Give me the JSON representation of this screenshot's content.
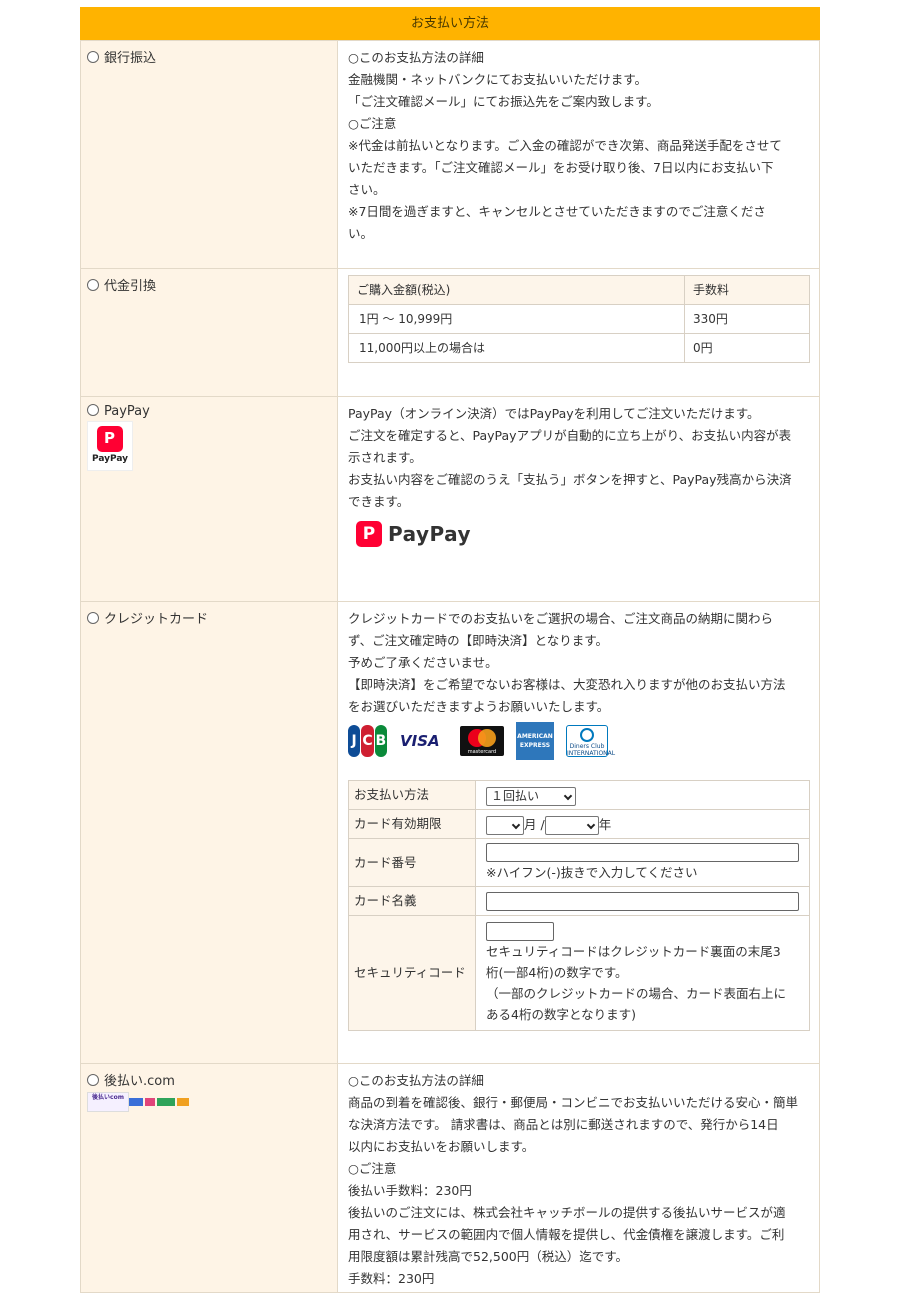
{
  "header": {
    "title": "お支払い方法"
  },
  "bank": {
    "label": "銀行振込",
    "lines": [
      "○このお支払方法の詳細",
      "金融機関・ネットバンクにてお支払いいただけます。",
      "「ご注文確認メール」にてお振込先をご案内致します。",
      "○ご注意",
      "※代金は前払いとなります。ご入金の確認ができ次第、商品発送手配をさせて",
      "いただきます。「ご注文確認メール」をお受け取り後、7日以内にお支払い下",
      "さい。",
      "※7日間を過ぎますと、キャンセルとさせていただきますのでご注意くださ",
      "い。"
    ]
  },
  "cod": {
    "label": "代金引換",
    "col_amount": "ご購入金額(税込)",
    "col_fee": "手数料",
    "rows": [
      {
        "amount": "1円 ～ 10,999円",
        "fee": "330円"
      },
      {
        "amount": "11,000円以上の場合は",
        "fee": "0円"
      }
    ]
  },
  "paypay": {
    "label": "PayPay",
    "logo_small_text": "PayPay",
    "lines": [
      "PayPay（オンライン決済）ではPayPayを利用してご注文いただけます。",
      "ご注文を確定すると、PayPayアプリが自動的に立ち上がり、お支払い内容が表",
      "示されます。",
      "お支払い内容をご確認のうえ「支払う」ボタンを押すと、PayPay残高から決済",
      "できます。"
    ],
    "logo_big_text": "PayPay"
  },
  "credit": {
    "label": "クレジットカード",
    "lines": [
      "クレジットカードでのお支払いをご選択の場合、ご注文商品の納期に関わら",
      "ず、ご注文確定時の【即時決済】となります。",
      "予めご了承くださいませ。",
      "【即時決済】をご希望でないお客様は、大変恐れ入りますが他のお支払い方法",
      "をお選びいただきますようお願いいたします。"
    ],
    "brands": {
      "jcb": "JCB",
      "visa": "VISA",
      "mastercard": "mastercard",
      "amex": "AMERICAN EXPRESS",
      "diners": "Diners Club INTERNATIONAL"
    },
    "form": {
      "payment_label": "お支払い方法",
      "payment_value": "１回払い",
      "expiry_label": "カード有効期限",
      "month_suffix": "月 /",
      "year_suffix": "年",
      "number_label": "カード番号",
      "number_note": "※ハイフン(-)抜きで入力してください",
      "name_label": "カード名義",
      "cvc_label": "セキュリティコード",
      "cvc_note1": "セキュリティコードはクレジットカード裏面の末尾3",
      "cvc_note2": "桁(一部4桁)の数字です。",
      "cvc_note3": "（一部のクレジットカードの場合、カード表面右上に",
      "cvc_note4": "ある4桁の数字となります)"
    }
  },
  "atobarai": {
    "label": "後払い.com",
    "logo_text": "後払いcom",
    "lines": [
      "○このお支払方法の詳細",
      "商品の到着を確認後、銀行・郵便局・コンビニでお支払いいただける安心・簡単",
      "な決済方法です。 請求書は、商品とは別に郵送されますので、発行から14日",
      "以内にお支払いをお願いします。",
      "○ご注意",
      "後払い手数料：230円",
      "後払いのご注文には、株式会社キャッチボールの提供する後払いサービスが適",
      "用され、サービスの範囲内で個人情報を提供し、代金債権を譲渡します。ご利",
      "用限度額は累計残高で52,500円（税込）迄です。",
      "手数料：230円"
    ]
  },
  "colors": {
    "header_bg": "#ffb300",
    "left_bg": "#fef4e6",
    "paypay_red": "#ff0033"
  }
}
